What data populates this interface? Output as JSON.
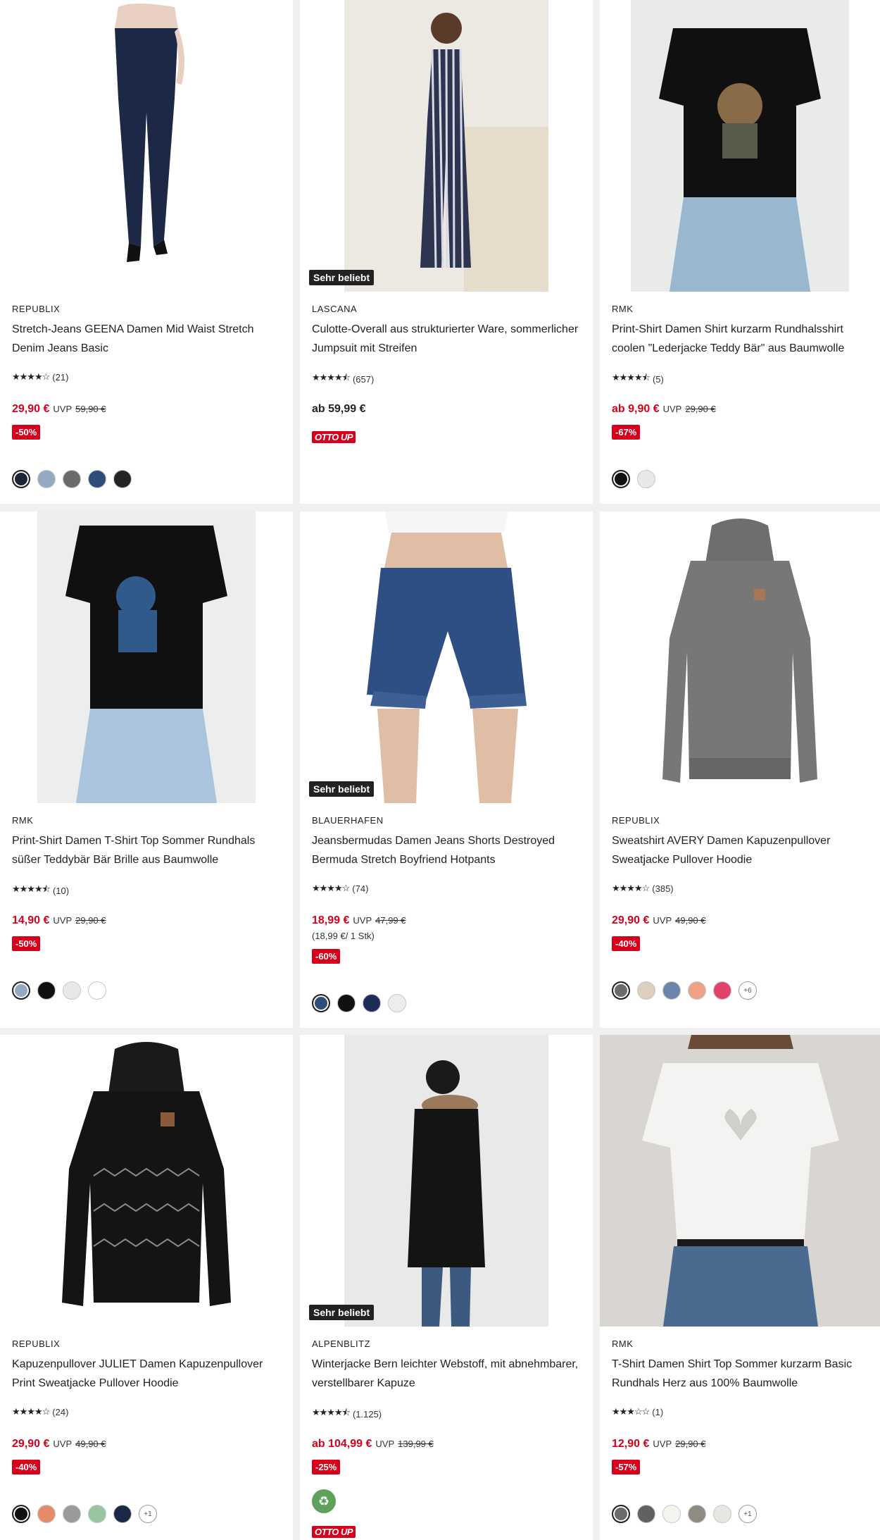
{
  "products": [
    {
      "brand": "REPUBLIX",
      "title": "Stretch-Jeans GEENA Damen Mid Waist Stretch Denim Jeans Basic",
      "stars": "★★★★☆",
      "reviews": "(21)",
      "price": "29,90 €",
      "uvp_label": "UVP",
      "uvp": "59,90 €",
      "discount": "-50%",
      "swatches": [
        "#1c2436",
        "#93aac1",
        "#6b6b6b",
        "#2f4d79",
        "#252525"
      ]
    },
    {
      "brand": "LASCANA",
      "title": "Culotte-Overall aus strukturierter Ware, sommerlicher Jumpsuit mit Streifen",
      "badge": "Sehr beliebt",
      "stars": "★★★★⯪",
      "reviews": "(657)",
      "price": "ab 59,99 €",
      "ottoup": "OTTO UP"
    },
    {
      "brand": "RMK",
      "title": "Print-Shirt Damen Shirt kurzarm Rundhalsshirt coolen \"Lederjacke Teddy Bär\" aus Baumwolle",
      "stars": "★★★★⯪",
      "reviews": "(5)",
      "price": "ab 9,90 €",
      "uvp_label": "UVP",
      "uvp": "29,90 €",
      "discount": "-67%",
      "swatches": [
        "#111111",
        "#e8e8e8"
      ]
    },
    {
      "brand": "RMK",
      "title": "Print-Shirt Damen T-Shirt Top Sommer Rundhals süßer Teddybär Bär Brille aus Baumwolle",
      "stars": "★★★★⯪",
      "reviews": "(10)",
      "price": "14,90 €",
      "uvp_label": "UVP",
      "uvp": "29,90 €",
      "discount": "-50%",
      "swatches": [
        "#93aac1",
        "#111111",
        "#e8e8e8",
        "#ffffff"
      ]
    },
    {
      "brand": "BLAUERHAFEN",
      "title": "Jeansbermudas Damen Jeans Shorts Destroyed Bermuda Stretch Boyfriend Hotpants",
      "badge": "Sehr beliebt",
      "stars": "★★★★☆",
      "reviews": "(74)",
      "price": "18,99 €",
      "uvp_label": "UVP",
      "uvp": "47,99 €",
      "unit_price": "(18,99 €/ 1 Stk)",
      "discount": "-60%",
      "swatches": [
        "#2f4d79",
        "#111111",
        "#1c2e55",
        "#ededed"
      ]
    },
    {
      "brand": "REPUBLIX",
      "title": "Sweatshirt AVERY Damen Kapuzenpullover Sweatjacke Pullover Hoodie",
      "stars": "★★★★☆",
      "reviews": "(385)",
      "price": "29,90 €",
      "uvp_label": "UVP",
      "uvp": "49,90 €",
      "discount": "-40%",
      "swatches": [
        "#6b6b6b",
        "#dccfbd",
        "#6a86ad",
        "#eea184",
        "#e0446b"
      ],
      "more": "+6"
    },
    {
      "brand": "REPUBLIX",
      "title": "Kapuzenpullover JULIET Damen Kapuzenpullover Print Sweatjacke Pullover Hoodie",
      "stars": "★★★★☆",
      "reviews": "(24)",
      "price": "29,90 €",
      "uvp_label": "UVP",
      "uvp": "49,90 €",
      "discount": "-40%",
      "swatches": [
        "#111111",
        "#e48c68",
        "#9a9a9a",
        "#98c4a0",
        "#1c2848"
      ],
      "more": "+1"
    },
    {
      "brand": "ALPENBLITZ",
      "title": "Winterjacke Bern leichter Webstoff, mit abnehmbarer, verstellbarer Kapuze",
      "badge": "Sehr beliebt",
      "stars": "★★★★⯪",
      "reviews": "(1.125)",
      "price": "ab 104,99 €",
      "uvp_label": "UVP",
      "uvp": "139,99 €",
      "discount": "-25%",
      "eco": "recycle-icon",
      "ottoup": "OTTO UP"
    },
    {
      "brand": "RMK",
      "title": "T-Shirt Damen Shirt Top Sommer kurzarm Basic Rundhals Herz aus 100% Baumwolle",
      "stars": "★★★☆☆",
      "reviews": "(1)",
      "price": "12,90 €",
      "uvp_label": "UVP",
      "uvp": "29,90 €",
      "discount": "-57%",
      "swatches": [
        "#6b6b6b",
        "#616161",
        "#f6f4ee",
        "#8e8c82",
        "#e6e6e2"
      ],
      "more": "+1"
    }
  ]
}
